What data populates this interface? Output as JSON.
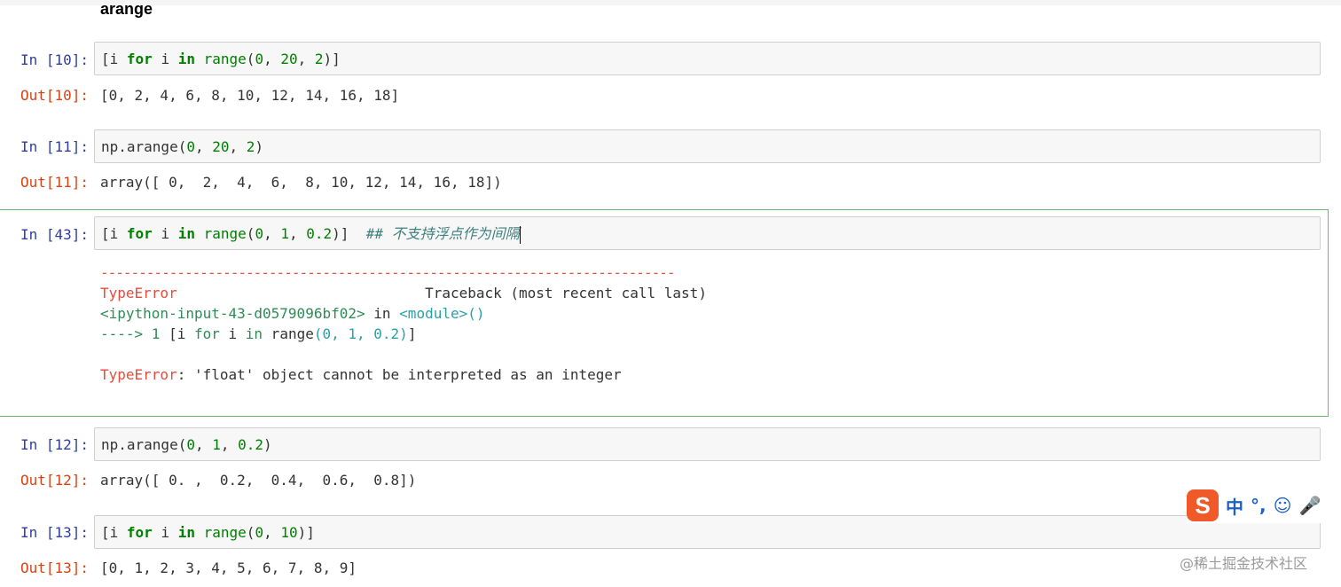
{
  "heading": "arange",
  "cells": [
    {
      "in_prompt": "In  [10]:",
      "code": "[i for i in range(0, 20, 2)]",
      "out_prompt": "Out[10]:",
      "output": "[0, 2, 4, 6, 8, 10, 12, 14, 16, 18]"
    },
    {
      "in_prompt": "In  [11]:",
      "code": "np.arange(0, 20, 2)",
      "out_prompt": "Out[11]:",
      "output": "array([ 0,  2,  4,  6,  8, 10, 12, 14, 16, 18])"
    },
    {
      "in_prompt": "In  [43]:",
      "code": "[i for i in range(0, 1, 0.2)]",
      "comment": "## 不支持浮点作为间隔"
    },
    {
      "in_prompt": "In  [12]:",
      "code": "np.arange(0, 1, 0.2)",
      "out_prompt": "Out[12]:",
      "output": "array([ 0. ,  0.2,  0.4,  0.6,  0.8])"
    },
    {
      "in_prompt": "In  [13]:",
      "code": "[i for i in range(0, 10)]",
      "out_prompt": "Out[13]:",
      "output": "[0, 1, 2, 3, 4, 5, 6, 7, 8, 9]"
    }
  ],
  "traceback": {
    "divider": "---------------------------------------------------------------------------",
    "error_name": "TypeError",
    "traceback_label": "Traceback (most recent call last)",
    "input_ref": "<ipython-input-43-d0579096bf02>",
    "in_word": "in",
    "module_ref": "<module>()",
    "arrow_line_prefix": "----> 1 ",
    "arrow_line_code": "[i for i in range(0, 1, 0.2)]",
    "final_error_name": "TypeError",
    "final_error_msg": ": 'float' object cannot be interpreted as an integer"
  },
  "ime": {
    "logo": "S",
    "items": [
      "中",
      "°,",
      "☺",
      "🎤"
    ]
  },
  "watermark": "@稀土掘金技术社区"
}
